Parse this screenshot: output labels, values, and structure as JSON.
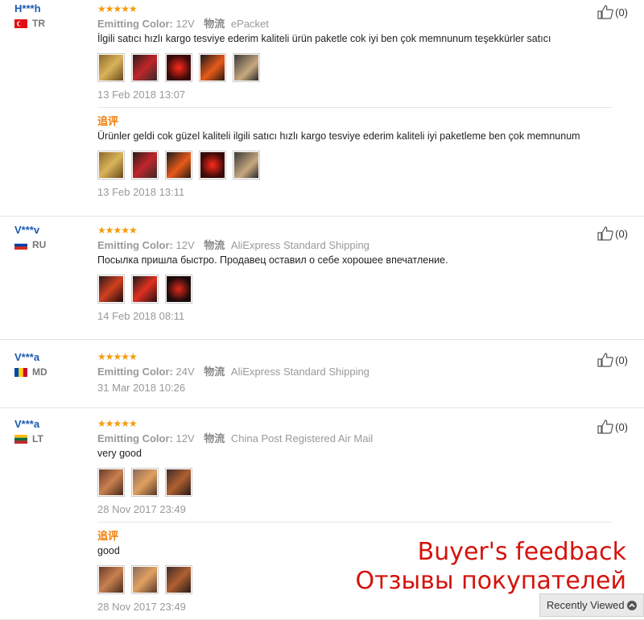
{
  "colors": {
    "username": "#1a5ab0",
    "stars": "#f49b0e",
    "additional": "#f07d0a",
    "overlay": "#d4130c"
  },
  "reviews": [
    {
      "user": "H***h",
      "country": "TR",
      "stars": "★★★★★",
      "helpful": "(0)",
      "color_label": "Emitting Color:",
      "color_value": "12V",
      "ship_icon": "物流",
      "shipping": "ePacket",
      "text": "İlgili satıcı hızlı kargo tesviye ederim kaliteli ürün paketle cok iyi ben çok memnunum teşekkürler satıcı",
      "date": "13 Feb 2018 13:07",
      "additional": {
        "label": "追评",
        "text": "Ürünler geldi cok güzel kaliteli ilgili satıcı hızlı kargo tesviye ederim kaliteli iyi paketleme ben çok memnunum",
        "date": "13 Feb 2018 13:11"
      }
    },
    {
      "user": "V***v",
      "country": "RU",
      "stars": "★★★★★",
      "helpful": "(0)",
      "color_label": "Emitting Color:",
      "color_value": "12V",
      "ship_icon": "物流",
      "shipping": "AliExpress Standard Shipping",
      "text": "Посылка пришла быстро. Продавец оставил о себе хорошее впечатление.",
      "date": "14 Feb 2018 08:11"
    },
    {
      "user": "V***a",
      "country": "MD",
      "stars": "★★★★★",
      "helpful": "(0)",
      "color_label": "Emitting Color:",
      "color_value": "24V",
      "ship_icon": "物流",
      "shipping": "AliExpress Standard Shipping",
      "date": "31 Mar 2018 10:26"
    },
    {
      "user": "V***a",
      "country": "LT",
      "stars": "★★★★★",
      "helpful": "(0)",
      "color_label": "Emitting Color:",
      "color_value": "12V",
      "ship_icon": "物流",
      "shipping": "China Post Registered Air Mail",
      "text": "very good",
      "date": "28 Nov 2017 23:49",
      "additional": {
        "label": "追评",
        "text": "good",
        "date": "28 Nov 2017 23:49"
      }
    }
  ],
  "overlay": {
    "line1": "Buyer's feedback",
    "line2": "Отзывы покупателей"
  },
  "recently_viewed": {
    "label": "Recently Viewed",
    "icon": "chevron-up-icon"
  }
}
